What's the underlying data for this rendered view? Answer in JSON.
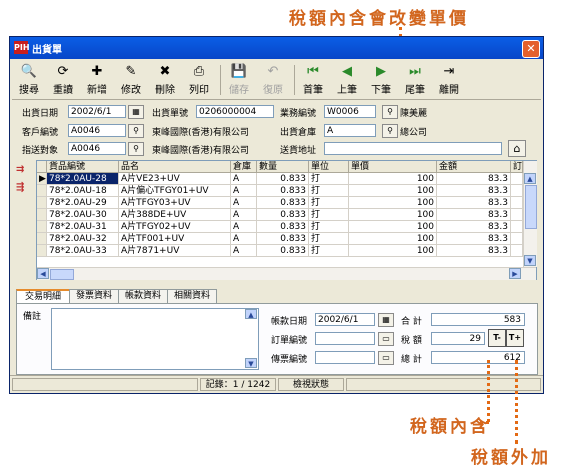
{
  "annotations": {
    "top": "稅額內含會改變單價",
    "bottom1": "稅額內含",
    "bottom2": "稅額外加"
  },
  "window": {
    "title": "出貨單",
    "app_icon": "PIH",
    "close": "✕"
  },
  "toolbar": [
    {
      "label": "搜尋",
      "icon": "🔍",
      "enabled": true
    },
    {
      "label": "重讀",
      "icon": "⟳",
      "enabled": true
    },
    {
      "label": "新增",
      "icon": "✚",
      "enabled": true
    },
    {
      "label": "修改",
      "icon": "✎",
      "enabled": true
    },
    {
      "label": "刪除",
      "icon": "✖",
      "enabled": true
    },
    {
      "label": "列印",
      "icon": "⎙",
      "enabled": true
    },
    {
      "label": "儲存",
      "icon": "💾",
      "enabled": false
    },
    {
      "label": "復原",
      "icon": "↶",
      "enabled": false
    },
    {
      "label": "首筆",
      "icon": "⏮",
      "enabled": true
    },
    {
      "label": "上筆",
      "icon": "◀",
      "enabled": true
    },
    {
      "label": "下筆",
      "icon": "▶",
      "enabled": true
    },
    {
      "label": "尾筆",
      "icon": "⏭",
      "enabled": true
    },
    {
      "label": "離開",
      "icon": "⇥",
      "enabled": true
    }
  ],
  "header": {
    "ship_date_label": "出貨日期",
    "ship_date": "2002/6/1",
    "ship_no_label": "出貨單號",
    "ship_no": "0206000004",
    "sales_no_label": "業務編號",
    "sales_no": "W0006",
    "sales_name": "陳美麗",
    "customer_no_label": "客戶編號",
    "customer_no": "A0046",
    "customer_name": "東峰國際(香港)有限公司",
    "warehouse_label": "出貨倉庫",
    "warehouse": "A",
    "warehouse_name": "總公司",
    "deliver_to_label": "指送對象",
    "deliver_to": "A0046",
    "deliver_to_name": "東峰國際(香港)有限公司",
    "address_label": "送貨地址",
    "address": ""
  },
  "grid": {
    "columns": [
      "貨品編號",
      "品名",
      "倉庫",
      "數量",
      "單位",
      "單價",
      "金額",
      "訂"
    ],
    "rows": [
      {
        "code": "78*2.0AU-28",
        "name": "A片VE23+UV",
        "wh": "A",
        "qty": "0.833",
        "unit": "打",
        "price": "100",
        "amount": "83.3"
      },
      {
        "code": "78*2.0AU-18",
        "name": "A片偏心TFGY01+UV",
        "wh": "A",
        "qty": "0.833",
        "unit": "打",
        "price": "100",
        "amount": "83.3"
      },
      {
        "code": "78*2.0AU-29",
        "name": "A片TFGY03+UV",
        "wh": "A",
        "qty": "0.833",
        "unit": "打",
        "price": "100",
        "amount": "83.3"
      },
      {
        "code": "78*2.0AU-30",
        "name": "A片388DE+UV",
        "wh": "A",
        "qty": "0.833",
        "unit": "打",
        "price": "100",
        "amount": "83.3"
      },
      {
        "code": "78*2.0AU-31",
        "name": "A片TFGY02+UV",
        "wh": "A",
        "qty": "0.833",
        "unit": "打",
        "price": "100",
        "amount": "83.3"
      },
      {
        "code": "78*2.0AU-32",
        "name": "A片TF001+UV",
        "wh": "A",
        "qty": "0.833",
        "unit": "打",
        "price": "100",
        "amount": "83.3"
      },
      {
        "code": "78*2.0AU-33",
        "name": "A片7871+UV",
        "wh": "A",
        "qty": "0.833",
        "unit": "打",
        "price": "100",
        "amount": "83.3"
      }
    ]
  },
  "tabs": [
    "交易明細",
    "發票資料",
    "帳款資料",
    "相關資料"
  ],
  "detail": {
    "memo_label": "備註",
    "pay_date_label": "帳款日期",
    "pay_date": "2002/6/1",
    "order_no_label": "訂單編號",
    "order_no": "",
    "voucher_no_label": "傳票編號",
    "voucher_no": "",
    "subtotal_label": "合 計",
    "subtotal": "583",
    "tax_label": "稅 額",
    "tax": "29",
    "tax_incl_btn": "T-",
    "tax_excl_btn": "T+",
    "total_label": "總 計",
    "total": "612"
  },
  "status": {
    "record": "記錄：1 / 1242",
    "mode": "檢視狀態"
  }
}
